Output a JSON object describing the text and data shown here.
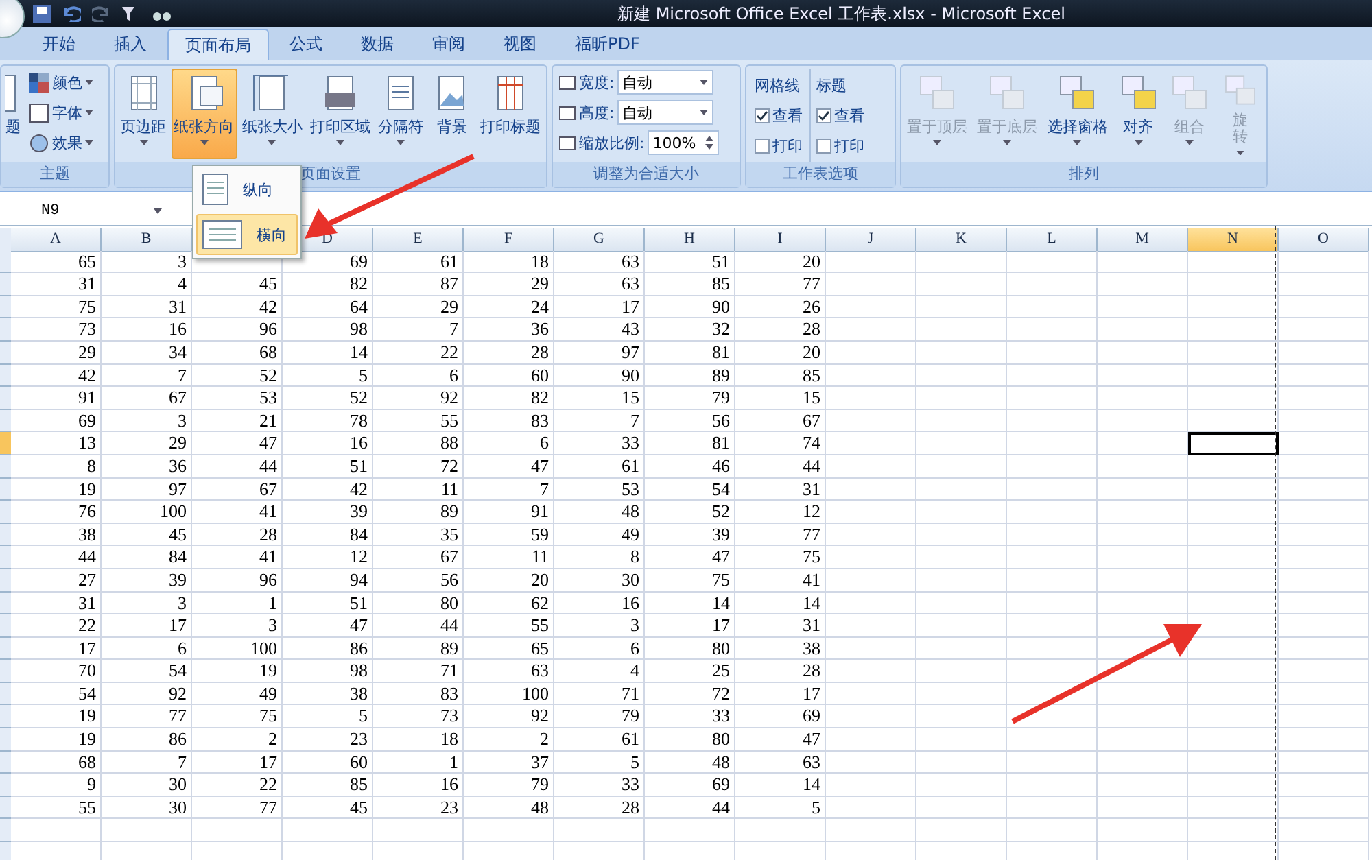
{
  "window": {
    "title": "新建 Microsoft Office Excel 工作表.xlsx - Microsoft Excel"
  },
  "tabs": [
    {
      "label": "开始",
      "selected": false
    },
    {
      "label": "插入",
      "selected": false
    },
    {
      "label": "页面布局",
      "selected": true
    },
    {
      "label": "公式",
      "selected": false
    },
    {
      "label": "数据",
      "selected": false
    },
    {
      "label": "审阅",
      "selected": false
    },
    {
      "label": "视图",
      "selected": false
    },
    {
      "label": "福昕PDF",
      "selected": false
    }
  ],
  "ribbon": {
    "groups": [
      {
        "kind": "themes",
        "label": "主题",
        "big": "题",
        "items": [
          "颜色",
          "字体",
          "效果"
        ]
      },
      {
        "kind": "buttons",
        "label": "页面设置",
        "buttons": [
          {
            "label": "页边距",
            "pressed": false,
            "menu": true
          },
          {
            "label": "纸张方向",
            "pressed": true,
            "menu": true
          },
          {
            "label": "纸张大小",
            "pressed": false,
            "menu": true
          },
          {
            "label": "打印区域",
            "pressed": false,
            "menu": true
          },
          {
            "label": "分隔符",
            "pressed": false,
            "menu": true
          },
          {
            "label": "背景",
            "pressed": false,
            "menu": false
          },
          {
            "label": "打印标题",
            "pressed": false,
            "menu": false
          }
        ]
      },
      {
        "kind": "scale",
        "label": "调整为合适大小",
        "fields": [
          {
            "label": "宽度:",
            "value": "自动",
            "spin": false
          },
          {
            "label": "高度:",
            "value": "自动",
            "spin": false
          },
          {
            "label": "缩放比例:",
            "value": "100%",
            "spin": true
          }
        ]
      },
      {
        "kind": "sheet_options",
        "label": "工作表选项",
        "sections": [
          {
            "title": "网格线",
            "options": [
              {
                "label": "查看",
                "checked": true
              },
              {
                "label": "打印",
                "checked": false
              }
            ]
          },
          {
            "title": "标题",
            "options": [
              {
                "label": "查看",
                "checked": true
              },
              {
                "label": "打印",
                "checked": false
              }
            ]
          }
        ]
      },
      {
        "kind": "arrange",
        "label": "排列",
        "buttons": [
          {
            "label": "置于顶层",
            "disabled": true
          },
          {
            "label": "置于底层",
            "disabled": true
          },
          {
            "label": "选择窗格",
            "disabled": false
          },
          {
            "label": "对齐",
            "disabled": false
          },
          {
            "label": "组合",
            "disabled": true
          },
          {
            "label": "旋转",
            "disabled": true
          }
        ]
      }
    ]
  },
  "orientation_menu": {
    "items": [
      {
        "label": "纵向",
        "selected": false
      },
      {
        "label": "横向",
        "selected": true
      }
    ]
  },
  "name_box": "N9",
  "sheet": {
    "columns": [
      {
        "label": "A",
        "selected": false
      },
      {
        "label": "B",
        "selected": false
      },
      {},
      {
        "label": "D",
        "selected": false
      },
      {
        "label": "E",
        "selected": false
      },
      {
        "label": "F",
        "selected": false
      },
      {
        "label": "G",
        "selected": false
      },
      {
        "label": "H",
        "selected": false
      },
      {
        "label": "I",
        "selected": false
      },
      {
        "label": "J",
        "selected": false
      },
      {
        "label": "K",
        "selected": false
      },
      {
        "label": "L",
        "selected": false
      },
      {
        "label": "M",
        "selected": false
      },
      {
        "label": "N",
        "selected": true
      },
      {
        "label": "O",
        "selected": false
      }
    ],
    "rows": [
      {
        "selected": false,
        "cells": [
          "65",
          "3",
          null,
          "69",
          "61",
          "18",
          "63",
          "51",
          "20"
        ]
      },
      {
        "selected": false,
        "cells": [
          "31",
          "4",
          "45",
          "82",
          "87",
          "29",
          "63",
          "85",
          "77"
        ]
      },
      {
        "selected": false,
        "cells": [
          "75",
          "31",
          "42",
          "64",
          "29",
          "24",
          "17",
          "90",
          "26"
        ]
      },
      {
        "selected": false,
        "cells": [
          "73",
          "16",
          "96",
          "98",
          "7",
          "36",
          "43",
          "32",
          "28"
        ]
      },
      {
        "selected": false,
        "cells": [
          "29",
          "34",
          "68",
          "14",
          "22",
          "28",
          "97",
          "81",
          "20"
        ]
      },
      {
        "selected": false,
        "cells": [
          "42",
          "7",
          "52",
          "5",
          "6",
          "60",
          "90",
          "89",
          "85"
        ]
      },
      {
        "selected": false,
        "cells": [
          "91",
          "67",
          "53",
          "52",
          "92",
          "82",
          "15",
          "79",
          "15"
        ]
      },
      {
        "selected": false,
        "cells": [
          "69",
          "3",
          "21",
          "78",
          "55",
          "83",
          "7",
          "56",
          "67"
        ]
      },
      {
        "selected": true,
        "cells": [
          "13",
          "29",
          "47",
          "16",
          "88",
          "6",
          "33",
          "81",
          "74"
        ]
      },
      {
        "selected": false,
        "cells": [
          "8",
          "36",
          "44",
          "51",
          "72",
          "47",
          "61",
          "46",
          "44"
        ]
      },
      {
        "selected": false,
        "cells": [
          "19",
          "97",
          "67",
          "42",
          "11",
          "7",
          "53",
          "54",
          "31"
        ]
      },
      {
        "selected": false,
        "cells": [
          "76",
          "100",
          "41",
          "39",
          "89",
          "91",
          "48",
          "52",
          "12"
        ]
      },
      {
        "selected": false,
        "cells": [
          "38",
          "45",
          "28",
          "84",
          "35",
          "59",
          "49",
          "39",
          "77"
        ]
      },
      {
        "selected": false,
        "cells": [
          "44",
          "84",
          "41",
          "12",
          "67",
          "11",
          "8",
          "47",
          "75"
        ]
      },
      {
        "selected": false,
        "cells": [
          "27",
          "39",
          "96",
          "94",
          "56",
          "20",
          "30",
          "75",
          "41"
        ]
      },
      {
        "selected": false,
        "cells": [
          "31",
          "3",
          "1",
          "51",
          "80",
          "62",
          "16",
          "14",
          "14"
        ]
      },
      {
        "selected": false,
        "cells": [
          "22",
          "17",
          "3",
          "47",
          "44",
          "55",
          "3",
          "17",
          "31"
        ]
      },
      {
        "selected": false,
        "cells": [
          "17",
          "6",
          "100",
          "86",
          "89",
          "65",
          "6",
          "80",
          "38"
        ]
      },
      {
        "selected": false,
        "cells": [
          "70",
          "54",
          "19",
          "98",
          "71",
          "63",
          "4",
          "25",
          "28"
        ]
      },
      {
        "selected": false,
        "cells": [
          "54",
          "92",
          "49",
          "38",
          "83",
          "100",
          "71",
          "72",
          "17"
        ]
      },
      {
        "selected": false,
        "cells": [
          "19",
          "77",
          "75",
          "5",
          "73",
          "92",
          "79",
          "33",
          "69"
        ]
      },
      {
        "selected": false,
        "cells": [
          "19",
          "86",
          "2",
          "23",
          "18",
          "2",
          "61",
          "80",
          "47"
        ]
      },
      {
        "selected": false,
        "cells": [
          "68",
          "7",
          "17",
          "60",
          "1",
          "37",
          "5",
          "48",
          "63"
        ]
      },
      {
        "selected": false,
        "cells": [
          "9",
          "30",
          "22",
          "85",
          "16",
          "79",
          "33",
          "69",
          "14"
        ]
      },
      {
        "selected": false,
        "cells": [
          "55",
          "30",
          "77",
          "45",
          "23",
          "48",
          "28",
          "44",
          "5"
        ]
      }
    ]
  }
}
